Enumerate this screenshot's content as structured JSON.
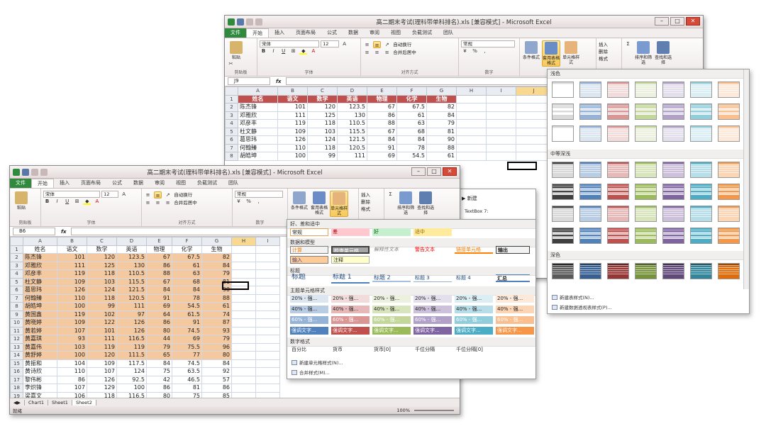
{
  "back_window": {
    "title": "高二期末考试(理科带单科排名).xls [兼容模式] - Microsoft Excel",
    "tabs": [
      "文件",
      "开始",
      "插入",
      "页面布局",
      "公式",
      "数据",
      "审阅",
      "视图",
      "负载测试",
      "团队"
    ],
    "name_box": "J9",
    "font_name": "宋体",
    "font_size": "12",
    "number_format": "常规",
    "wrap_label": "自动换行",
    "merge_label": "合并后居中",
    "groups": [
      "剪贴板",
      "字体",
      "对齐方式",
      "数字"
    ],
    "ribbon_buttons": [
      "条件格式",
      "套用表格格式",
      "单元格样式",
      "插入",
      "删除",
      "格式",
      "排序和筛选",
      "查找和选择"
    ],
    "paste_label": "粘贴",
    "columns": [
      "A",
      "B",
      "C",
      "D",
      "E",
      "F",
      "G",
      "H",
      "I",
      "J"
    ],
    "headers": [
      "姓名",
      "语文",
      "数学",
      "英语",
      "物理",
      "化学",
      "生物"
    ],
    "rows": [
      [
        "陈杰锋",
        "101",
        "120",
        "123.5",
        "67",
        "67.5",
        "82"
      ],
      [
        "邓雅欣",
        "111",
        "125",
        "130",
        "86",
        "61",
        "84"
      ],
      [
        "邓彦丰",
        "119",
        "118",
        "110.5",
        "88",
        "63",
        "79"
      ],
      [
        "杜文静",
        "109",
        "103",
        "115.5",
        "67",
        "68",
        "81"
      ],
      [
        "葛思玮",
        "126",
        "124",
        "121.5",
        "84",
        "84",
        "90"
      ],
      [
        "何翰臻",
        "110",
        "118",
        "120.5",
        "91",
        "78",
        "88"
      ],
      [
        "胡皓坤",
        "100",
        "99",
        "111",
        "69",
        "54.5",
        "61"
      ]
    ]
  },
  "front_window": {
    "title": "高二期末考试(理科带单科排名).xls [兼容模式] - Microsoft Excel",
    "tabs": [
      "文件",
      "开始",
      "插入",
      "页面布局",
      "公式",
      "数据",
      "审阅",
      "视图",
      "负载测试",
      "团队"
    ],
    "name_box": "B6",
    "font_name": "宋体",
    "font_size": "12",
    "number_format": "常规",
    "wrap_label": "自动换行",
    "merge_label": "合并后居中",
    "groups": [
      "剪贴板",
      "字体",
      "对齐方式",
      "数字"
    ],
    "ribbon_buttons": [
      "条件格式",
      "套用表格格式",
      "单元格样式",
      "插入",
      "删除",
      "格式",
      "排序和筛选",
      "查找和选择"
    ],
    "paste_label": "粘贴",
    "columns": [
      "A",
      "B",
      "C",
      "D",
      "E",
      "F",
      "G",
      "H",
      "I"
    ],
    "headers": [
      "姓名",
      "语文",
      "数学",
      "英语",
      "物理",
      "化学",
      "生物"
    ],
    "rows": [
      [
        "陈杰锋",
        "101",
        "120",
        "123.5",
        "67",
        "67.5",
        "82"
      ],
      [
        "邓雅欣",
        "111",
        "125",
        "130",
        "86",
        "61",
        "84"
      ],
      [
        "邓彦丰",
        "119",
        "118",
        "110.5",
        "88",
        "63",
        "79"
      ],
      [
        "杜文静",
        "109",
        "103",
        "115.5",
        "67",
        "68",
        "81"
      ],
      [
        "葛思玮",
        "126",
        "124",
        "121.5",
        "84",
        "84",
        "90"
      ],
      [
        "何翰臻",
        "110",
        "118",
        "120.5",
        "91",
        "78",
        "88"
      ],
      [
        "胡皓坤",
        "100",
        "99",
        "111",
        "69",
        "54.5",
        "61"
      ],
      [
        "黄国鑫",
        "119",
        "102",
        "97",
        "64",
        "61.5",
        "74"
      ],
      [
        "黄晓婷",
        "109",
        "122",
        "126",
        "86",
        "91",
        "87"
      ],
      [
        "黄若婷",
        "107",
        "101",
        "126",
        "80",
        "74.5",
        "93"
      ],
      [
        "黄嘉琪",
        "93",
        "111",
        "116.5",
        "44",
        "69",
        "79"
      ],
      [
        "黄嘉伟",
        "103",
        "119",
        "119",
        "79",
        "75.5",
        "96"
      ],
      [
        "黄舒婷",
        "100",
        "120",
        "111.5",
        "65",
        "77",
        "80"
      ],
      [
        "黄振和",
        "104",
        "109",
        "117.5",
        "84",
        "74.5",
        "84"
      ],
      [
        "黄诗欣",
        "110",
        "107",
        "124",
        "75",
        "63.5",
        "92"
      ],
      [
        "黎伟彬",
        "86",
        "126",
        "92.5",
        "42",
        "46.5",
        "57"
      ],
      [
        "李炽锋",
        "107",
        "129",
        "100",
        "86",
        "81",
        "86"
      ],
      [
        "梁嘉文",
        "106",
        "118",
        "116.5",
        "80",
        "75",
        "85"
      ],
      [
        "梁培昌",
        "106",
        "111",
        "119",
        "99",
        "79",
        "74"
      ],
      [
        "梁咏琳",
        "95",
        "111",
        "108",
        "67",
        "58.5",
        "57"
      ]
    ],
    "sheet_tabs": [
      "Chart1",
      "Sheet1",
      "Sheet2"
    ],
    "status_text": "就绪",
    "zoom": "100%"
  },
  "cell_styles_panel": {
    "section_good_bad": "好、差和适中",
    "good_bad": [
      "常规",
      "差",
      "好",
      "适中"
    ],
    "section_data_model": "数据和模型",
    "data_model": [
      "计算",
      "检查单元格",
      "解释性文本",
      "警告文本",
      "链接单元格",
      "输出",
      "输入",
      "注释"
    ],
    "section_titles": "标题",
    "titles": [
      "标题",
      "标题 1",
      "标题 2",
      "标题 3",
      "标题 4",
      "汇总"
    ],
    "section_theme": "主题单元格样式",
    "theme_20": "20% - 强...",
    "theme_40": "40% - 强...",
    "theme_60": "60% - 强...",
    "theme_accent": "强调文字...",
    "section_number": "数字格式",
    "number_formats": [
      "百分比",
      "货币",
      "货币[0]",
      "千位分隔",
      "千位分隔[0]"
    ],
    "menu_new": "新建单元格样式(N)...",
    "menu_merge": "合并样式(M)..."
  },
  "side_panel": {
    "button": "新建",
    "item": "TextBox 7:"
  },
  "table_format_panel": {
    "section_light": "浅色",
    "section_medium": "中等深浅",
    "section_dark": "深色",
    "menu_new_table": "新建表样式(N)...",
    "menu_new_pivot": "新建数据透视表样式(P)..."
  },
  "colors": {
    "header_red": "#c0504d",
    "selection_orange": "#f5c9a0",
    "excel_green": "#2f8a3e"
  }
}
